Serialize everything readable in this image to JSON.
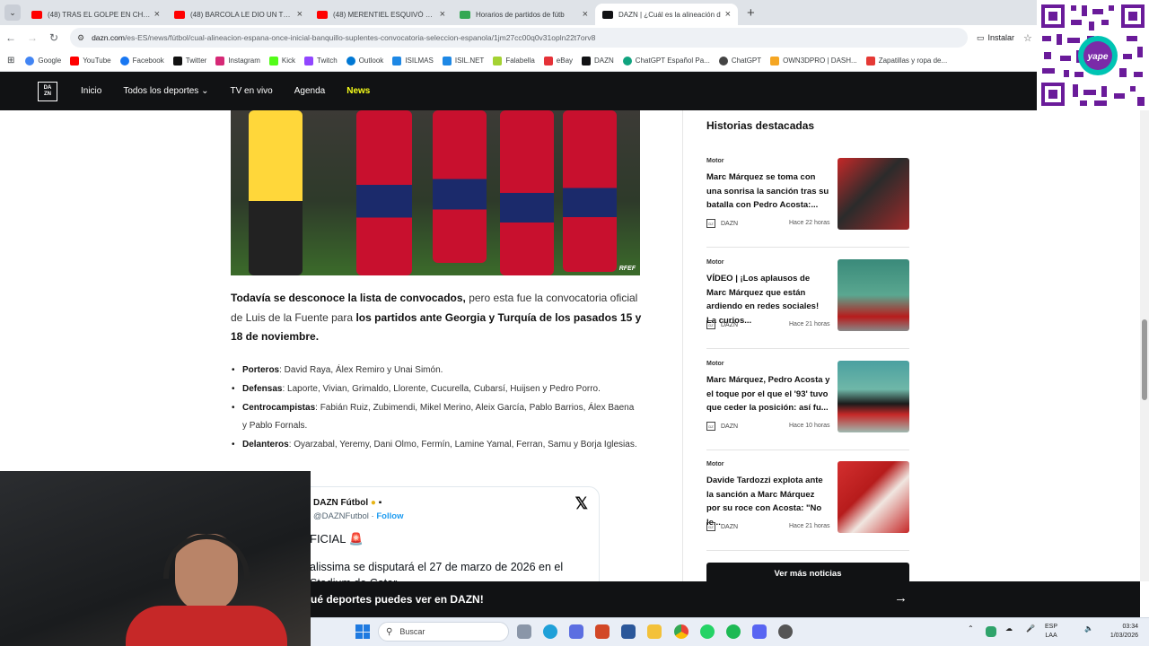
{
  "colors": {
    "dazn_black": "#111214",
    "news_yellow": "#f7ff1a",
    "twitter_blue": "#1d9bf0",
    "qr_purple": "#6a1b9a",
    "yape_teal": "#00c4b3"
  },
  "browser": {
    "tabs": [
      {
        "title": "(48) TRAS EL GOLPE EN CHAMP",
        "icon": "youtube-icon",
        "color": "#ff0000"
      },
      {
        "title": "(48) BARCOLA LE DIO UN TRIUN",
        "icon": "youtube-icon",
        "color": "#ff0000"
      },
      {
        "title": "(48) MERENTIEL ESQUIVÓ LA D",
        "icon": "youtube-icon",
        "color": "#ff0000"
      },
      {
        "title": "Horarios de partidos de fútb",
        "icon": "globe-icon",
        "color": "#33a852"
      },
      {
        "title": "DAZN | ¿Cuál es la alineación d",
        "icon": "dazn-icon",
        "color": "#111214"
      }
    ],
    "url_host": "dazn.com",
    "url_path": "/es-ES/news/fútbol/cual-alineacion-espana-once-inicial-banquillo-suplentes-convocatoria-seleccion-espanola/1jm27cc00q0v31opln22t7orv8",
    "install_label": "Instalar",
    "bookmarks": [
      {
        "label": "Google",
        "color": "#4285f4"
      },
      {
        "label": "YouTube",
        "color": "#ff0000"
      },
      {
        "label": "Facebook",
        "color": "#1877f2"
      },
      {
        "label": "Twitter",
        "color": "#111111"
      },
      {
        "label": "Instagram",
        "color": "#d62976"
      },
      {
        "label": "Kick",
        "color": "#53fc18"
      },
      {
        "label": "Twitch",
        "color": "#9146ff"
      },
      {
        "label": "Outlook",
        "color": "#0078d4"
      },
      {
        "label": "ISILMAS",
        "color": "#1e88e5"
      },
      {
        "label": "ISIL.NET",
        "color": "#1e88e5"
      },
      {
        "label": "Falabella",
        "color": "#a4d233"
      },
      {
        "label": "eBay",
        "color": "#e53238"
      },
      {
        "label": "DAZN",
        "color": "#111214"
      },
      {
        "label": "ChatGPT Español Pa...",
        "color": "#10a37f"
      },
      {
        "label": "ChatGPT",
        "color": "#444444"
      },
      {
        "label": "OWN3DPRO | DASH...",
        "color": "#f5a623"
      },
      {
        "label": "Zapatillas y ropa de...",
        "color": "#e53935"
      }
    ]
  },
  "dazn_nav": {
    "logo": "DAZN",
    "items": [
      "Inicio",
      "Todos los deportes",
      "TV en vivo",
      "Agenda",
      "News"
    ]
  },
  "hero": {
    "credit": "RFEF"
  },
  "article": {
    "intro_bold1": "Todavía se desconoce la lista de convocados,",
    "intro_normal": " pero esta fue la convocatoria oficial de Luis de la Fuente para ",
    "intro_bold2": "los partidos ante Georgia y Turquía de los pasados 15 y 18 de noviembre.",
    "lineup": [
      {
        "label": "Porteros",
        "players": ": David Raya, Álex Remiro y Unai Simón."
      },
      {
        "label": "Defensas",
        "players": ": Laporte, Vivian, Grimaldo, Llorente, Cucurella, Cubarsí, Huijsen y Pedro Porro."
      },
      {
        "label": "Centrocampistas",
        "players": ": Fabián Ruiz, Zubimendi, Mikel Merino, Aleix García, Pablo Barrios, Álex Baena y Pablo Fornals."
      },
      {
        "label": "Delanteros",
        "players": ": Oyarzabal, Yeremy, Dani Olmo, Fermín, Lamine Yamal, Ferran, Samu y Borja Iglesias."
      }
    ]
  },
  "tweet": {
    "name": "DAZN Fútbol",
    "handle": "@DAZNFutbol",
    "dot": " · ",
    "follow": "Follow",
    "line1": "FICIAL",
    "line2": "alissima se disputará el 27 de marzo de 2026 en el",
    "line3": "Stadium de Catar"
  },
  "sidebar": {
    "title": "Historias destacadas",
    "stories": [
      {
        "category": "Motor",
        "headline": "Marc Márquez se toma con una sonrisa la sanción tras su batalla con Pedro Acosta:...",
        "source": "DAZN",
        "time": "Hace 22 horas"
      },
      {
        "category": "Motor",
        "headline": "VÍDEO | ¡Los aplausos de Marc Márquez que están ardiendo en redes sociales! La curios...",
        "source": "DAZN",
        "time": "Hace 21 horas"
      },
      {
        "category": "Motor",
        "headline": "Marc Márquez, Pedro Acosta y el toque por el que el '93' tuvo que ceder la posición: así fu...",
        "source": "DAZN",
        "time": "Hace 10 horas"
      },
      {
        "category": "Motor",
        "headline": "Davide Tardozzi explota ante la sanción a Marc Márquez por su roce con Acosta: \"No le...",
        "source": "DAZN",
        "time": "Hace 21 horas"
      }
    ],
    "more_button": "Ver más noticias"
  },
  "bottom_banner": {
    "text": "ué deportes puedes ver en DAZN!"
  },
  "taskbar": {
    "search_placeholder": "Buscar",
    "lang_line1": "ESP",
    "lang_line2": "LAA",
    "time": "03:34",
    "date": "1/03/2026"
  }
}
